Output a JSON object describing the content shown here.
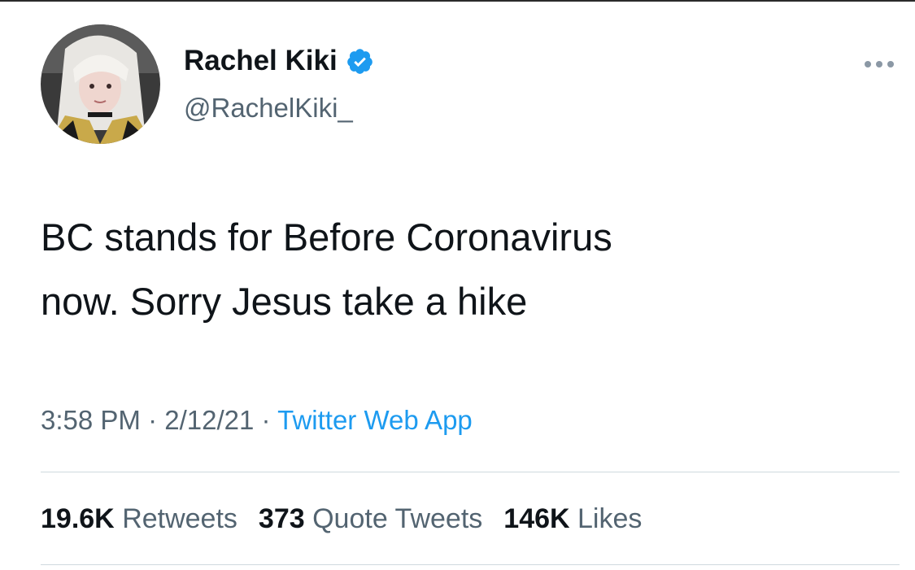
{
  "author": {
    "display_name": "Rachel Kiki",
    "handle": "@RachelKiki_",
    "verified": true,
    "avatar_icon": "profile-photo"
  },
  "tweet": {
    "text_line1": "BC stands for Before Coronavirus",
    "text_line2": "now. Sorry Jesus take a hike",
    "time": "3:58 PM",
    "separator": "·",
    "date": "2/12/21",
    "source": "Twitter Web App"
  },
  "stats": {
    "retweets_count": "19.6K",
    "retweets_label": "Retweets",
    "quotes_count": "373",
    "quotes_label": "Quote Tweets",
    "likes_count": "146K",
    "likes_label": "Likes"
  },
  "colors": {
    "text": "#0f1419",
    "secondary": "#536471",
    "accent": "#1d9bf0",
    "divider": "#cfd9de"
  }
}
